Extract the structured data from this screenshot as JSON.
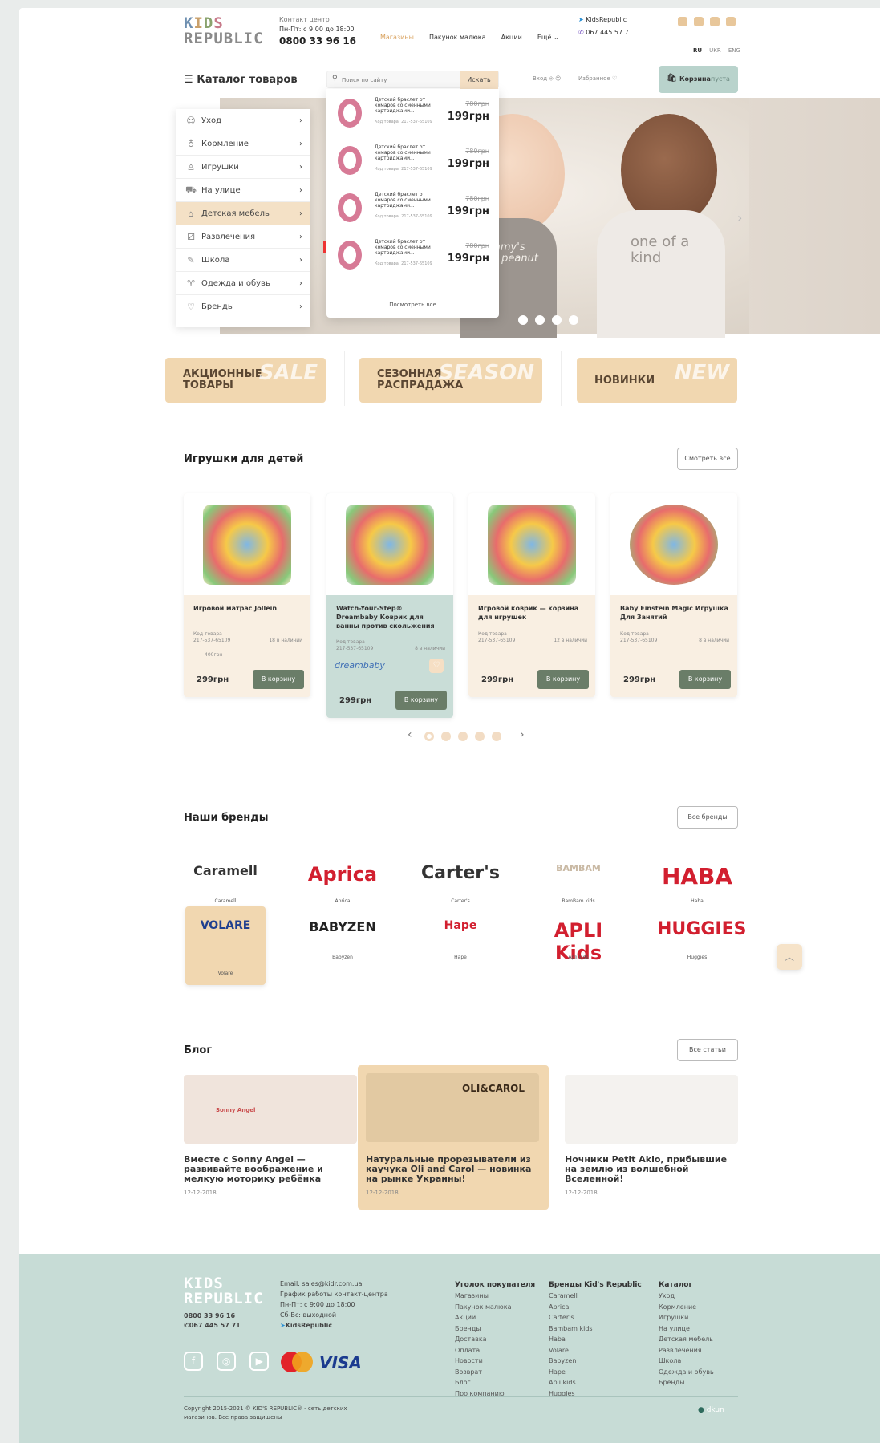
{
  "header": {
    "logo_line1": "KIDS",
    "logo_line2": "REPUBLIC",
    "contact_label": "Контакт центр",
    "hours": "Пн-Пт: с 9:00 до 18:00",
    "phone": "0800 33 96 16",
    "nav": [
      "Магазины",
      "Пакунок малюка",
      "Акции",
      "Ещё"
    ],
    "telegram": "KidsRepublic",
    "viber": "067 445 57 71",
    "langs": [
      "RU",
      "UKR",
      "ENG"
    ]
  },
  "subheader": {
    "catalog_label": "Каталог товаров",
    "search_placeholder": "Поиск по сайту",
    "search_button": "Искать",
    "login": "Вход",
    "favorites": "Избранное",
    "cart_label": "Корзина",
    "cart_status": "пуста"
  },
  "menu": [
    {
      "label": "Уход",
      "icon": "care-icon"
    },
    {
      "label": "Кормление",
      "icon": "feeding-icon"
    },
    {
      "label": "Игрушки",
      "icon": "toys-icon"
    },
    {
      "label": "На улице",
      "icon": "stroller-icon"
    },
    {
      "label": "Детская мебель",
      "icon": "furniture-icon"
    },
    {
      "label": "Развлечения",
      "icon": "games-icon"
    },
    {
      "label": "Школа",
      "icon": "school-icon"
    },
    {
      "label": "Одежда и обувь",
      "icon": "clothes-icon"
    },
    {
      "label": "Бренды",
      "icon": "heart-icon"
    }
  ],
  "suggestions": {
    "items": [
      {
        "name": "Детский браслет от комаров со сменными картриджами...",
        "code": "Код товара: 217-537-65109",
        "old_price": "780грн",
        "price": "199грн"
      },
      {
        "name": "Детский браслет от комаров со сменными картриджами...",
        "code": "Код товара: 217-537-65109",
        "old_price": "780грн",
        "price": "199грн"
      },
      {
        "name": "Детский браслет от комаров со сменными картриджами...",
        "code": "Код товара: 217-537-65109",
        "old_price": "780грн",
        "price": "199грн"
      },
      {
        "name": "Детский браслет от комаров со сменными картриджами...",
        "code": "Код товара: 217-537-65109",
        "old_price": "780грн",
        "price": "199грн"
      }
    ],
    "see_all": "Посмотреть все"
  },
  "hero": {
    "shirt1": "Mommy's little peanut",
    "shirt2": "one of a kind"
  },
  "promos": [
    {
      "label": "АКЦИОННЫЕ ТОВАРЫ",
      "deco": "SALE"
    },
    {
      "label": "СЕЗОННАЯ РАСПРАДАЖА",
      "deco": "SEASON"
    },
    {
      "label": "НОВИНКИ",
      "deco": "NEW"
    }
  ],
  "toys": {
    "title": "Игрушки для детей",
    "see_all": "Смотреть все",
    "code_label": "Код товара",
    "buy": "В корзину",
    "items": [
      {
        "name": "Игровой матрас Jollein",
        "code": "217-537-65109",
        "stock": "18 в наличии",
        "old": "400грн",
        "price": "299грн"
      },
      {
        "name": "Watch-Your-Step® Dreambaby Коврик для ванны против скольжения",
        "code": "217-537-65109",
        "stock": "8 в наличии",
        "old": "",
        "price": "299грн",
        "brand": "dreambaby"
      },
      {
        "name": "Игровой коврик — корзина для игрушек",
        "code": "217-537-65109",
        "stock": "12 в наличии",
        "old": "",
        "price": "299грн"
      },
      {
        "name": "Baby Einstein Magic Игрушка Для Занятий",
        "code": "217-537-65109",
        "stock": "8 в наличии",
        "old": "",
        "price": "299грн"
      }
    ]
  },
  "brands": {
    "title": "Наши бренды",
    "all": "Все бренды",
    "items": [
      {
        "mark": "Caramell",
        "cap": "Caramell",
        "color": "#333333"
      },
      {
        "mark": "Aprica",
        "cap": "Aprica",
        "color": "#d21f2f"
      },
      {
        "mark": "Carter's",
        "cap": "Carter's",
        "color": "#333333"
      },
      {
        "mark": "BAMBAM",
        "cap": "BamBam kids",
        "color": "#c9b9a4"
      },
      {
        "mark": "HABA",
        "cap": "Haba",
        "color": "#d21f2f"
      },
      {
        "mark": "VOLARE",
        "cap": "Volare",
        "color": "#1f3f8f"
      },
      {
        "mark": "BABYZEN",
        "cap": "Babyzen",
        "color": "#222222"
      },
      {
        "mark": "Hape",
        "cap": "Hape",
        "color": "#d21f2f"
      },
      {
        "mark": "APLI Kids",
        "cap": "Apli kids",
        "color": "#d21f2f"
      },
      {
        "mark": "HUGGIES",
        "cap": "Huggies",
        "color": "#d21f2f"
      }
    ]
  },
  "blog": {
    "title": "Блог",
    "all": "Все статьи",
    "items": [
      {
        "title": "Вместе с Sonny Angel — развивайте воображение и мелкую моторику ребёнка",
        "date": "12-12-2018",
        "img_text": "Sonny Angel"
      },
      {
        "title": "Натуральные прорезыватели из каучука Oli and Carol — новинка на рынке Украины!",
        "date": "12-12-2018",
        "img_text": "OLI&CAROL"
      },
      {
        "title": "Ночники Petit Akio, прибывшие на землю из волшебной Вселенной!",
        "date": "12-12-2018",
        "img_text": ""
      }
    ]
  },
  "footer": {
    "logo_line1": "KIDS",
    "logo_line2": "REPUBLIC",
    "phone": "0800 33 96 16",
    "viber": "067 445 57 71",
    "email": "Email: sales@kidr.com.ua",
    "schedule": "График работы контакт-центра",
    "weekdays": "Пн-Пт: с 9:00 до 18:00",
    "weekend": "Сб-Вс: выходной",
    "telegram": "KidsRepublic",
    "cols": [
      {
        "title": "Уголок покупателя",
        "items": [
          "Магазины",
          "Пакунок малюка",
          "Акции",
          "Бренды",
          "Доставка",
          "Оплата",
          "Новости",
          "Возврат",
          "Блог",
          "Про компанию"
        ]
      },
      {
        "title": "Бренды Kid's Republic",
        "items": [
          "Caramell",
          "Aprica",
          "Carter's",
          "Bambam kids",
          "Haba",
          "Volare",
          "Babyzen",
          "Hape",
          "Apli kids",
          "Huggies"
        ]
      },
      {
        "title": "Каталог",
        "items": [
          "Уход",
          "Кормление",
          "Игрушки",
          "На улице",
          "Детская мебель",
          "Развлечения",
          "Школа",
          "Одежда и обувь",
          "Бренды"
        ]
      }
    ],
    "copyright1": "Copyright 2015-2021 © KID'S REPUBLIC® - сеть детских",
    "copyright2": "магазинов. Все права защищены",
    "dev": "dkun",
    "cards": [
      "MasterCard",
      "VISA"
    ]
  }
}
